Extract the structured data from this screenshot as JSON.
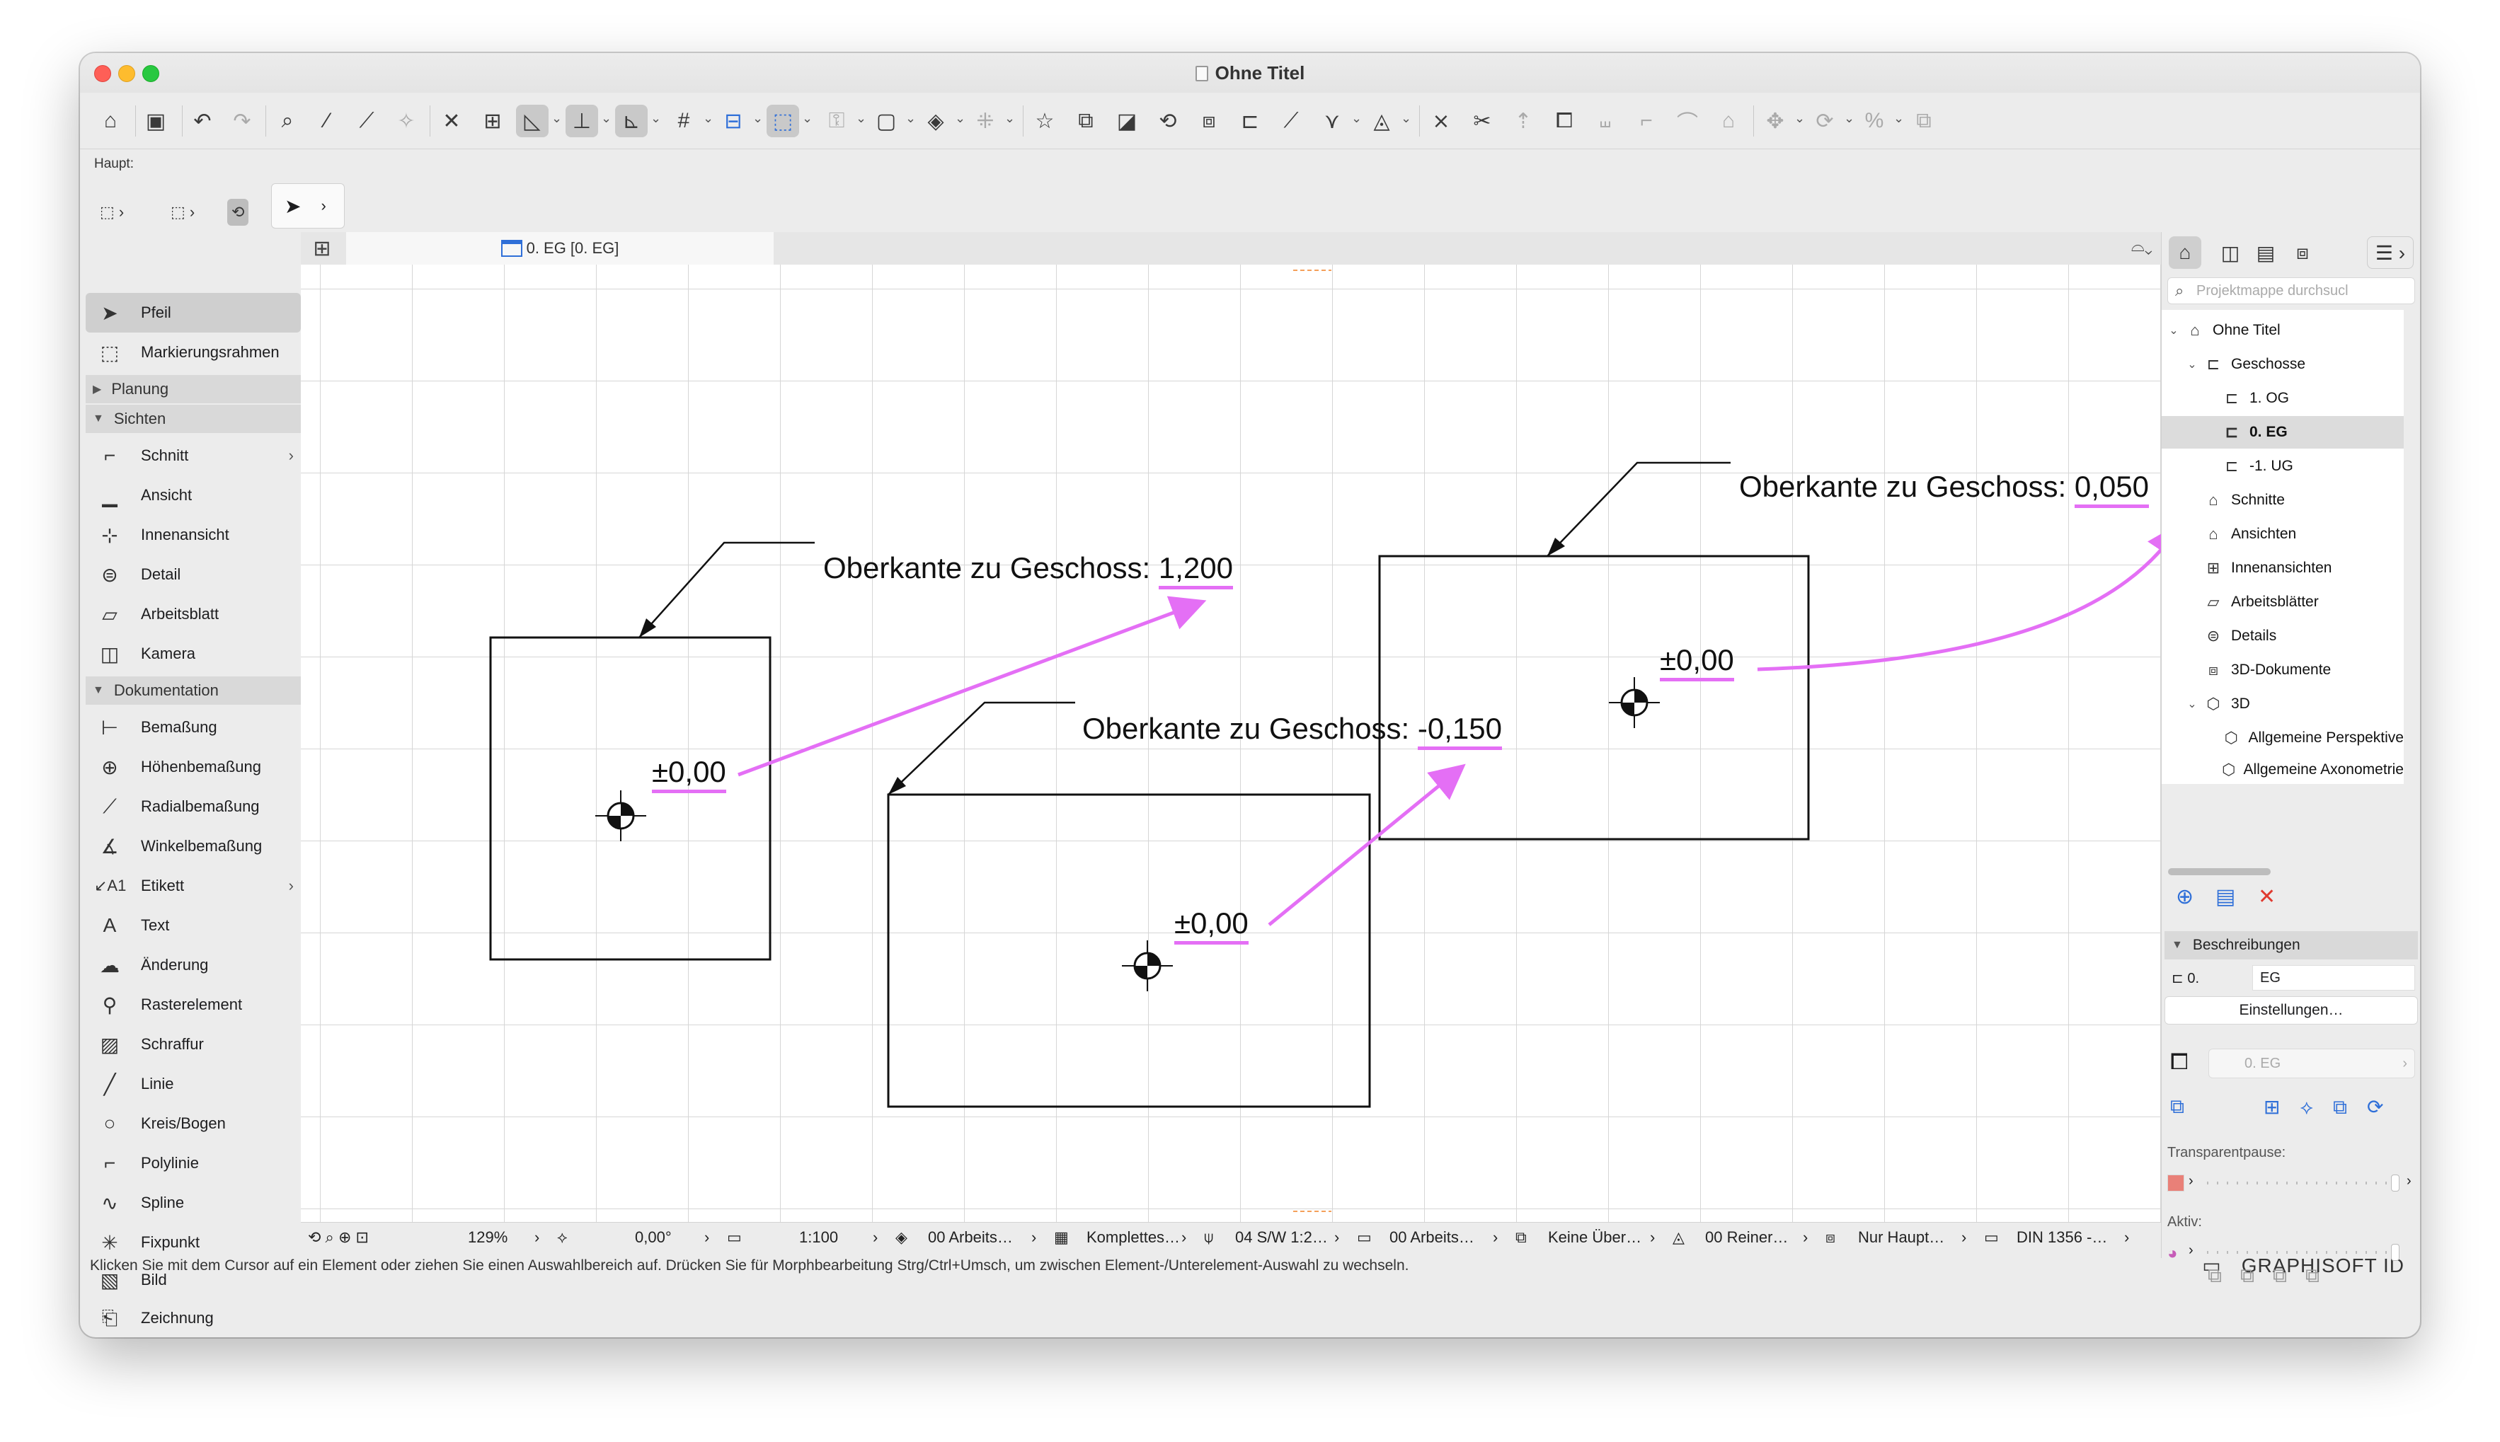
{
  "window": {
    "title": "Ohne Titel",
    "colors": {
      "accent": "#2f6fd8",
      "annotation_magenta": "#e46ff5",
      "delete_red": "#e03a2f"
    }
  },
  "strip": {
    "haupt_label": "Haupt:"
  },
  "toolbox": {
    "selected": "Pfeil",
    "tools_top": [
      {
        "name": "pfeil",
        "label": "Pfeil",
        "icon": "arrow-icon"
      },
      {
        "name": "markierungsrahmen",
        "label": "Markierungsrahmen",
        "icon": "marquee-icon"
      }
    ],
    "groups": {
      "planung": "Planung",
      "sichten": "Sichten",
      "dokumentation": "Dokumentation"
    },
    "sichten": [
      {
        "label": "Schnitt",
        "icon": "section-icon",
        "has_submenu": true
      },
      {
        "label": "Ansicht",
        "icon": "elevation-icon"
      },
      {
        "label": "Innenansicht",
        "icon": "interior-elevation-icon"
      },
      {
        "label": "Detail",
        "icon": "detail-icon"
      },
      {
        "label": "Arbeitsblatt",
        "icon": "worksheet-icon"
      },
      {
        "label": "Kamera",
        "icon": "camera-icon"
      }
    ],
    "dokumentation": [
      {
        "label": "Bemaßung",
        "icon": "dimension-icon"
      },
      {
        "label": "Höhenbemaßung",
        "icon": "level-dimension-icon"
      },
      {
        "label": "Radialbemaßung",
        "icon": "radial-dimension-icon"
      },
      {
        "label": "Winkelbemaßung",
        "icon": "angle-dimension-icon"
      },
      {
        "label": "Etikett",
        "icon": "label-icon",
        "has_submenu": true
      },
      {
        "label": "Text",
        "icon": "text-icon"
      },
      {
        "label": "Änderung",
        "icon": "change-icon"
      },
      {
        "label": "Rasterelement",
        "icon": "grid-element-icon"
      },
      {
        "label": "Schraffur",
        "icon": "fill-icon"
      },
      {
        "label": "Linie",
        "icon": "line-icon"
      },
      {
        "label": "Kreis/Bogen",
        "icon": "circle-icon"
      },
      {
        "label": "Polylinie",
        "icon": "polyline-icon"
      },
      {
        "label": "Spline",
        "icon": "spline-icon"
      },
      {
        "label": "Fixpunkt",
        "icon": "hotspot-icon"
      },
      {
        "label": "Bild",
        "icon": "image-icon"
      },
      {
        "label": "Zeichnung",
        "icon": "drawing-icon"
      }
    ]
  },
  "canvas": {
    "tab_label": "0. EG [0. EG]",
    "annotations": [
      {
        "header": "Oberkante zu Geschoss: ",
        "value": "1,200",
        "level": "±0,00"
      },
      {
        "header": "Oberkante zu Geschoss: ",
        "value": "-0,150",
        "level": "±0,00"
      },
      {
        "header": "Oberkante zu Geschoss: ",
        "value": "0,050",
        "level": "±0,00"
      }
    ]
  },
  "statusbar": {
    "zoom": "129%",
    "angle": "0,00°",
    "scale": "1:100",
    "layer_combo": "00 Arbeits…",
    "model_view": "Komplettes…",
    "pen_set": "04 S/W 1:2…",
    "view_map": "00 Arbeits…",
    "overrides": "Keine Über…",
    "renovation": "00 Reiner…",
    "structure": "Nur Haupt…",
    "dimension_std": "DIN 1356 -…",
    "hint": "Klicken Sie mit dem Cursor auf ein Element oder ziehen Sie einen Auswahlbereich auf. Drücken Sie für Morphbearbeitung Strg/Ctrl+Umsch, um zwischen Element-/Unterelement-Auswahl zu wechseln.",
    "brand": "GRAPHISOFT ID"
  },
  "navigator": {
    "search_placeholder": "Projektmappe durchsucl",
    "tree": [
      {
        "label": "Ohne Titel",
        "indent": 0,
        "disclosure": "open",
        "icon": "project-icon"
      },
      {
        "label": "Geschosse",
        "indent": 1,
        "disclosure": "open",
        "icon": "stories-icon"
      },
      {
        "label": "1. OG",
        "indent": 2,
        "icon": "story-icon"
      },
      {
        "label": "0. EG",
        "indent": 2,
        "icon": "story-icon",
        "selected": true
      },
      {
        "label": "-1. UG",
        "indent": 2,
        "icon": "story-icon"
      },
      {
        "label": "Schnitte",
        "indent": 1,
        "icon": "sections-icon"
      },
      {
        "label": "Ansichten",
        "indent": 1,
        "icon": "elevations-icon"
      },
      {
        "label": "Innenansichten",
        "indent": 1,
        "icon": "interior-elevations-icon"
      },
      {
        "label": "Arbeitsblätter",
        "indent": 1,
        "icon": "worksheets-icon"
      },
      {
        "label": "Details",
        "indent": 1,
        "icon": "details-icon"
      },
      {
        "label": "3D-Dokumente",
        "indent": 1,
        "icon": "3d-documents-icon"
      },
      {
        "label": "3D",
        "indent": 1,
        "disclosure": "open",
        "icon": "3d-icon"
      },
      {
        "label": "Allgemeine Perspektive",
        "indent": 2,
        "icon": "perspective-icon"
      },
      {
        "label": "Allgemeine Axonometrie",
        "indent": 2,
        "icon": "axonometry-icon"
      }
    ],
    "section_title": "Beschreibungen",
    "story_number": "0.",
    "story_name": "EG",
    "settings_button": "Einstellungen…",
    "layer_value": "0. EG",
    "transparent_label": "Transparentpause:",
    "aktiv_label": "Aktiv:"
  }
}
